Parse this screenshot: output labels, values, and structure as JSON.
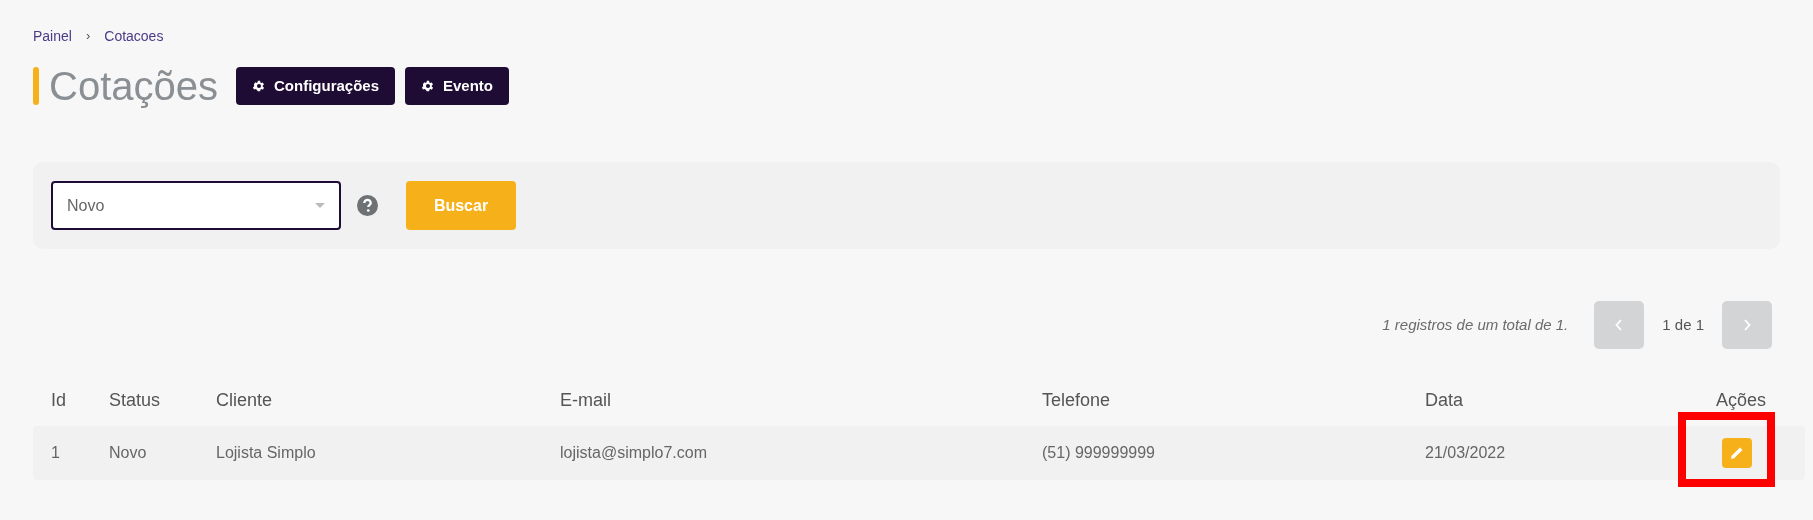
{
  "breadcrumb": [
    "Painel",
    "Cotacoes"
  ],
  "breadcrumb_separator": "›",
  "title": "Cotações",
  "header_buttons": [
    "Configurações",
    "Evento"
  ],
  "filter": {
    "status_value": "Novo",
    "search_button": "Buscar"
  },
  "pagination": {
    "summary": "1 registros de um total de 1.",
    "page": "1 de 1"
  },
  "table": {
    "columns": [
      "Id",
      "Status",
      "Cliente",
      "E-mail",
      "Telefone",
      "Data",
      "Ações"
    ],
    "rows": [
      {
        "cells": [
          "1",
          "Novo",
          "Lojista Simplo",
          "lojista@simplo7.com",
          "(51) 999999999",
          "21/03/2022"
        ]
      }
    ]
  },
  "highlight": true
}
